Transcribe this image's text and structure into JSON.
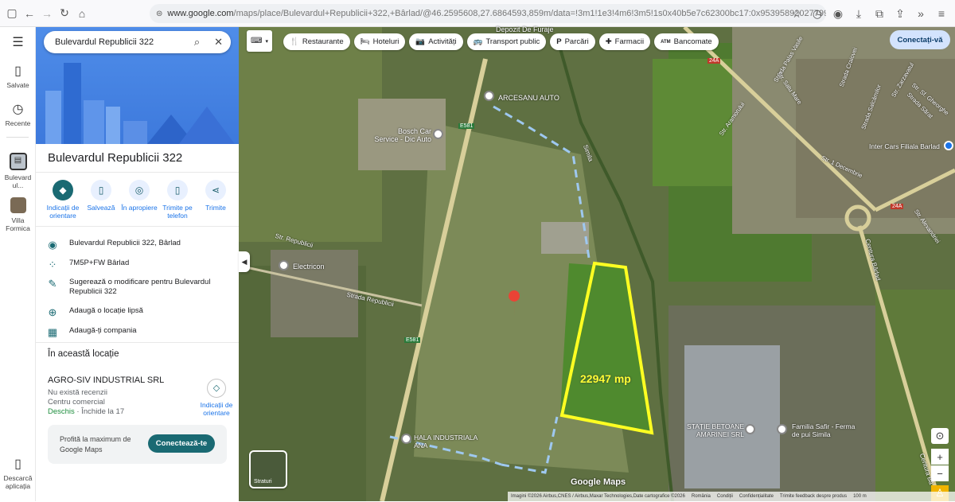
{
  "browser": {
    "url_host": "www.google.com",
    "url_rest": "/maps/place/Bulevardul+Republicii+322,+Bârlad/@46.2595608,27.6864593,859m/data=!3m1!1e3!4m6!3m5!1s0x40b5e7c62300bc17:0x9539589202779902!8m2!3d46.2586267!4d27.6873278!16"
  },
  "rail": [
    {
      "label": "Salvate",
      "icon": "bookmark-icon"
    },
    {
      "label": "Recente",
      "icon": "history-icon"
    },
    {
      "label": "Bulevard ul...",
      "icon": "place-thumb"
    },
    {
      "label": "Villa Formica",
      "icon": "place-thumb"
    },
    {
      "label": "Descarcă aplicația",
      "icon": "phone-icon"
    }
  ],
  "search": {
    "value": "Bulevardul Republicii 322"
  },
  "place": {
    "title": "Bulevardul Republicii 322"
  },
  "actions": [
    {
      "label": "Indicații de orientare",
      "icon": "directions-icon"
    },
    {
      "label": "Salvează",
      "icon": "bookmark-icon"
    },
    {
      "label": "În apropiere",
      "icon": "nearby-icon"
    },
    {
      "label": "Trimite pe telefon",
      "icon": "phone-icon"
    },
    {
      "label": "Trimite",
      "icon": "share-icon"
    }
  ],
  "info": [
    {
      "text": "Bulevardul Republicii 322, Bârlad",
      "icon": "pin-icon"
    },
    {
      "text": "7M5P+FW Bârlad",
      "icon": "plus-code-icon"
    },
    {
      "text": "Sugerează o modificare pentru Bulevardul Republicii 322",
      "icon": "edit-icon"
    },
    {
      "text": "Adaugă o locație lipsă",
      "icon": "add-location-icon"
    },
    {
      "text": "Adaugă-ți compania",
      "icon": "add-business-icon"
    }
  ],
  "section": {
    "title": "În această locație"
  },
  "business": {
    "name": "AGRO-SIV INDUSTRIAL SRL",
    "reviews": "Nu există recenzii",
    "category": "Centru comercial",
    "open": "Deschis",
    "closes": " · Închide la 17",
    "directions": "Indicații de orientare"
  },
  "promo": {
    "text": "Profită la maximum de Google Maps",
    "button": "Conectează-te"
  },
  "chips": [
    {
      "label": "Restaurante",
      "icon": "🍴"
    },
    {
      "label": "Hoteluri",
      "icon": "🛏"
    },
    {
      "label": "Activități",
      "icon": "📷"
    },
    {
      "label": "Transport public",
      "icon": "🚌"
    },
    {
      "label": "Parcări",
      "icon": "P"
    },
    {
      "label": "Farmacii",
      "icon": "✚"
    },
    {
      "label": "Bancomate",
      "icon": "ATM"
    }
  ],
  "login": "Conectați-vă",
  "layers": "Straturi",
  "map_labels": {
    "depozit": "Depozit De Furaje",
    "arcesanu": "ARCESANU AUTO",
    "bosch": "Bosch Car Service - Dic Auto",
    "electricon": "Electricon",
    "hala": "HALA INDUSTRIALA ANA",
    "statie": "STAȚIE BETOANE AMARINEI SRL",
    "safir": "Familia Safir - Ferma de pui Simila",
    "intercars": "Inter Cars Filiala Barlad",
    "str_rep": "Str. Republicii",
    "strada_rep": "Strada Republicii",
    "simila": "Simila",
    "centura": "Centura Bârlad",
    "centura2": "Centura Bâ",
    "e581a": "E581",
    "e581b": "E581",
    "r24a": "24A",
    "r24a2": "24A",
    "strpalas": "Strada Palas Vasile",
    "str1dec": "Str. 1 Decembrie",
    "strsatu": "Str. Satu Mare",
    "strcraiovei": "Strada Craiovei",
    "strsarat": "Strada Sărat",
    "stralexandria": "Str. Alexandriei",
    "strastramor": "Str. Aramorului",
    "strsalcamilor": "Strada Salcâmilor",
    "strzarzavatul": "Str. Zarzavatul",
    "strsfantul": "Str. Sf. Gheorghe"
  },
  "area_label": "22947 mp",
  "google_maps": "Google Maps",
  "footer": [
    "Imagini ©2026 Airbus,CNES / Airbus,Maxar Technologies,Date cartografice ©2026",
    "România",
    "Condiții",
    "Confidențialitate",
    "Trimite feedback despre produs",
    "100 m"
  ]
}
